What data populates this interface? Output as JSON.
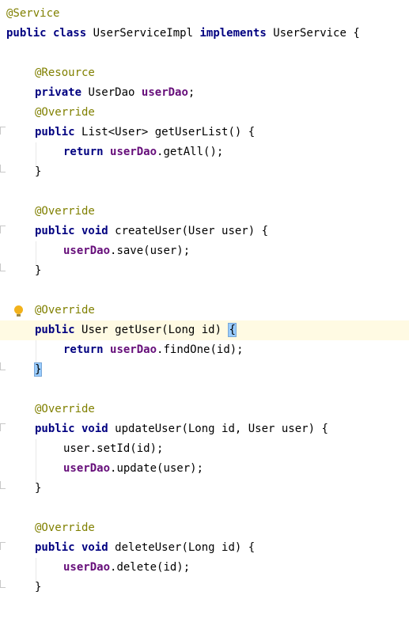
{
  "editor": {
    "lines": [
      {
        "annotation": "@Service"
      },
      {
        "kw": "public class",
        "name": "UserServiceImpl",
        "kw2": "implements",
        "iface": "UserService {"
      },
      {},
      {
        "annotation": "@Resource"
      },
      {
        "kw": "private",
        "type": "UserDao",
        "field": "userDao",
        "end": ";"
      },
      {
        "annotation": "@Override"
      },
      {
        "kw": "public",
        "sig": "List<User> getUserList() {"
      },
      {
        "kw": "return",
        "field": "userDao",
        "call": ".getAll();"
      },
      {
        "brace": "}"
      },
      {},
      {
        "annotation": "@Override"
      },
      {
        "kw": "public void",
        "sig": "createUser(User user) {"
      },
      {
        "field": "userDao",
        "call": ".save(user);"
      },
      {
        "brace": "}"
      },
      {},
      {
        "annotation": "@Override"
      },
      {
        "kw": "public",
        "sig": "User getUser(Long id)",
        "brace": "{"
      },
      {
        "kw": "return",
        "field": "userDao",
        "call": ".findOne(id);"
      },
      {
        "brace": "}"
      },
      {},
      {
        "annotation": "@Override"
      },
      {
        "kw": "public void",
        "sig": "updateUser(Long id, User user) {"
      },
      {
        "text": "user.setId(id);"
      },
      {
        "field": "userDao",
        "call": ".update(user);"
      },
      {
        "brace": "}"
      },
      {},
      {
        "annotation": "@Override"
      },
      {
        "kw": "public void",
        "sig": "deleteUser(Long id) {"
      },
      {
        "field": "userDao",
        "call": ".delete(id);"
      },
      {
        "brace": "}"
      }
    ]
  },
  "colors": {
    "keyword": "#000080",
    "annotation": "#808000",
    "field": "#660e7a",
    "current_line": "#fffae3",
    "brace_match": "#99ccff",
    "bulb": "#f2b21b"
  },
  "icons": {
    "intention": "lightbulb-icon"
  }
}
